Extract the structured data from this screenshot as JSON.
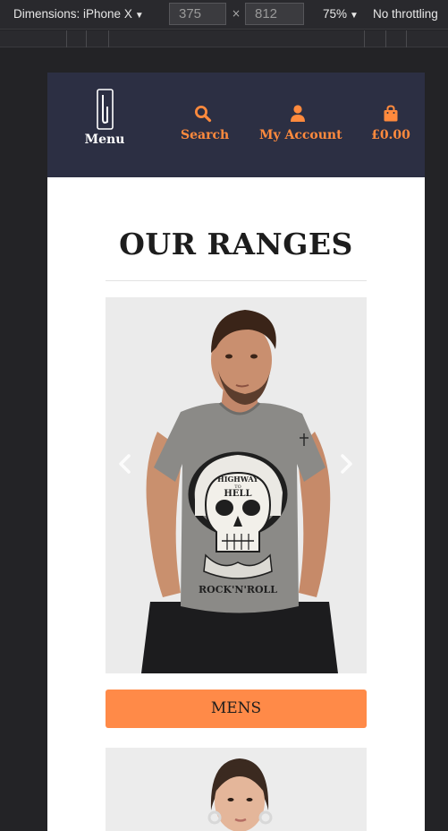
{
  "devtools": {
    "dimensions_label": "Dimensions: iPhone X",
    "width_value": "375",
    "height_value": "812",
    "times": "×",
    "zoom": "75%",
    "throttling": "No throttling",
    "caret": "▼"
  },
  "header": {
    "menu_label": "Menu",
    "search_label": "Search",
    "account_label": "My Account",
    "cart_label": "£0.00"
  },
  "main": {
    "title": "OUR RANGES",
    "slides": [
      {
        "shirt_top": "HIGHWAY",
        "shirt_mid": "TO",
        "shirt_main": "HELL",
        "shirt_bottom": "ROCK'N'ROLL",
        "button_label": "MENS"
      }
    ]
  },
  "colors": {
    "header_bg": "#2c2f43",
    "accent": "#ff8a3d",
    "button_bg": "#ff8a48"
  }
}
